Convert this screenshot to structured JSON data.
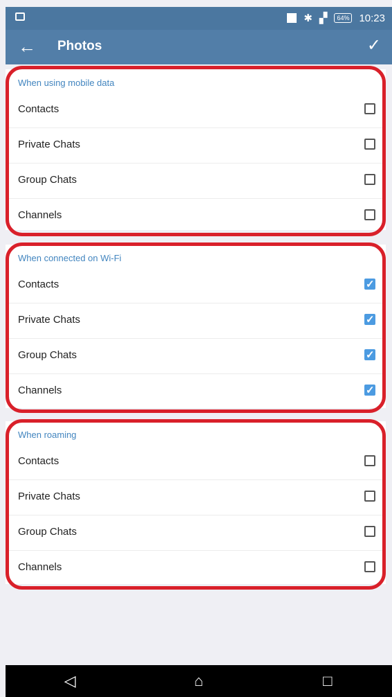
{
  "status_bar": {
    "time": "10:23",
    "battery": "64%"
  },
  "app_bar": {
    "back_icon": "arrow-back-icon",
    "title": "Photos",
    "confirm_icon": "checkmark-icon"
  },
  "sections": [
    {
      "header": "When using mobile data",
      "items": [
        {
          "label": "Contacts",
          "checked": false
        },
        {
          "label": "Private Chats",
          "checked": false
        },
        {
          "label": "Group Chats",
          "checked": false
        },
        {
          "label": "Channels",
          "checked": false
        }
      ]
    },
    {
      "header": "When connected on Wi-Fi",
      "items": [
        {
          "label": "Contacts",
          "checked": true
        },
        {
          "label": "Private Chats",
          "checked": true
        },
        {
          "label": "Group Chats",
          "checked": true
        },
        {
          "label": "Channels",
          "checked": true
        }
      ]
    },
    {
      "header": "When roaming",
      "items": [
        {
          "label": "Contacts",
          "checked": false
        },
        {
          "label": "Private Chats",
          "checked": false
        },
        {
          "label": "Group Chats",
          "checked": false
        },
        {
          "label": "Channels",
          "checked": false
        }
      ]
    }
  ],
  "colors": {
    "app_bar": "#527ea8",
    "section_header": "#4285bf",
    "checkbox_on": "#4c9be1",
    "highlight": "#d9202a"
  },
  "nav_bar": {
    "icons": [
      "back-triangle-icon",
      "home-icon",
      "recents-icon"
    ]
  }
}
